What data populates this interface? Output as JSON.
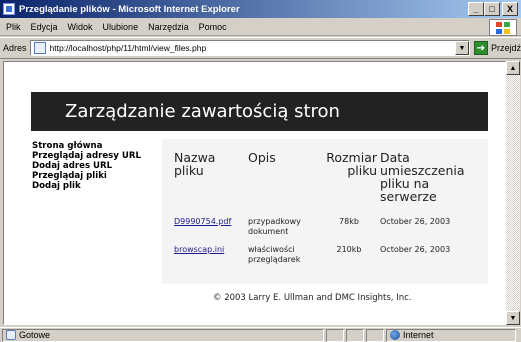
{
  "window": {
    "title": "Przeglądanie plików - Microsoft Internet Explorer",
    "minimize": "_",
    "maximize": "□",
    "close": "X"
  },
  "menu": {
    "items": [
      "Plik",
      "Edycja",
      "Widok",
      "Ulubione",
      "Narzędzia",
      "Pomoc"
    ]
  },
  "address_bar": {
    "label": "Adres",
    "url": "http://localhost/php/11/html/view_files.php",
    "go_label": "Przejdź"
  },
  "page": {
    "banner_title": "Zarządzanie zawartością stron",
    "nav": [
      "Strona główna",
      "Przeglądaj adresy URL",
      "Dodaj adres URL",
      "Przeglądaj pliki",
      "Dodaj plik"
    ],
    "table": {
      "headers": {
        "name": "Nazwa pliku",
        "description": "Opis",
        "size": "Rozmiar pliku",
        "date": "Data umieszczenia pliku na serwerze"
      },
      "rows": [
        {
          "name": "D9990754.pdf",
          "description": "przypadkowy dokument",
          "size": "78kb",
          "date": "October 26, 2003"
        },
        {
          "name": "browscap.ini",
          "description": "właściwości przeglądarek",
          "size": "210kb",
          "date": "October 26, 2003"
        }
      ]
    },
    "footer": "© 2003 Larry E. Ullman and DMC Insights, Inc."
  },
  "status_bar": {
    "text": "Gotowe",
    "zone": "Internet"
  }
}
